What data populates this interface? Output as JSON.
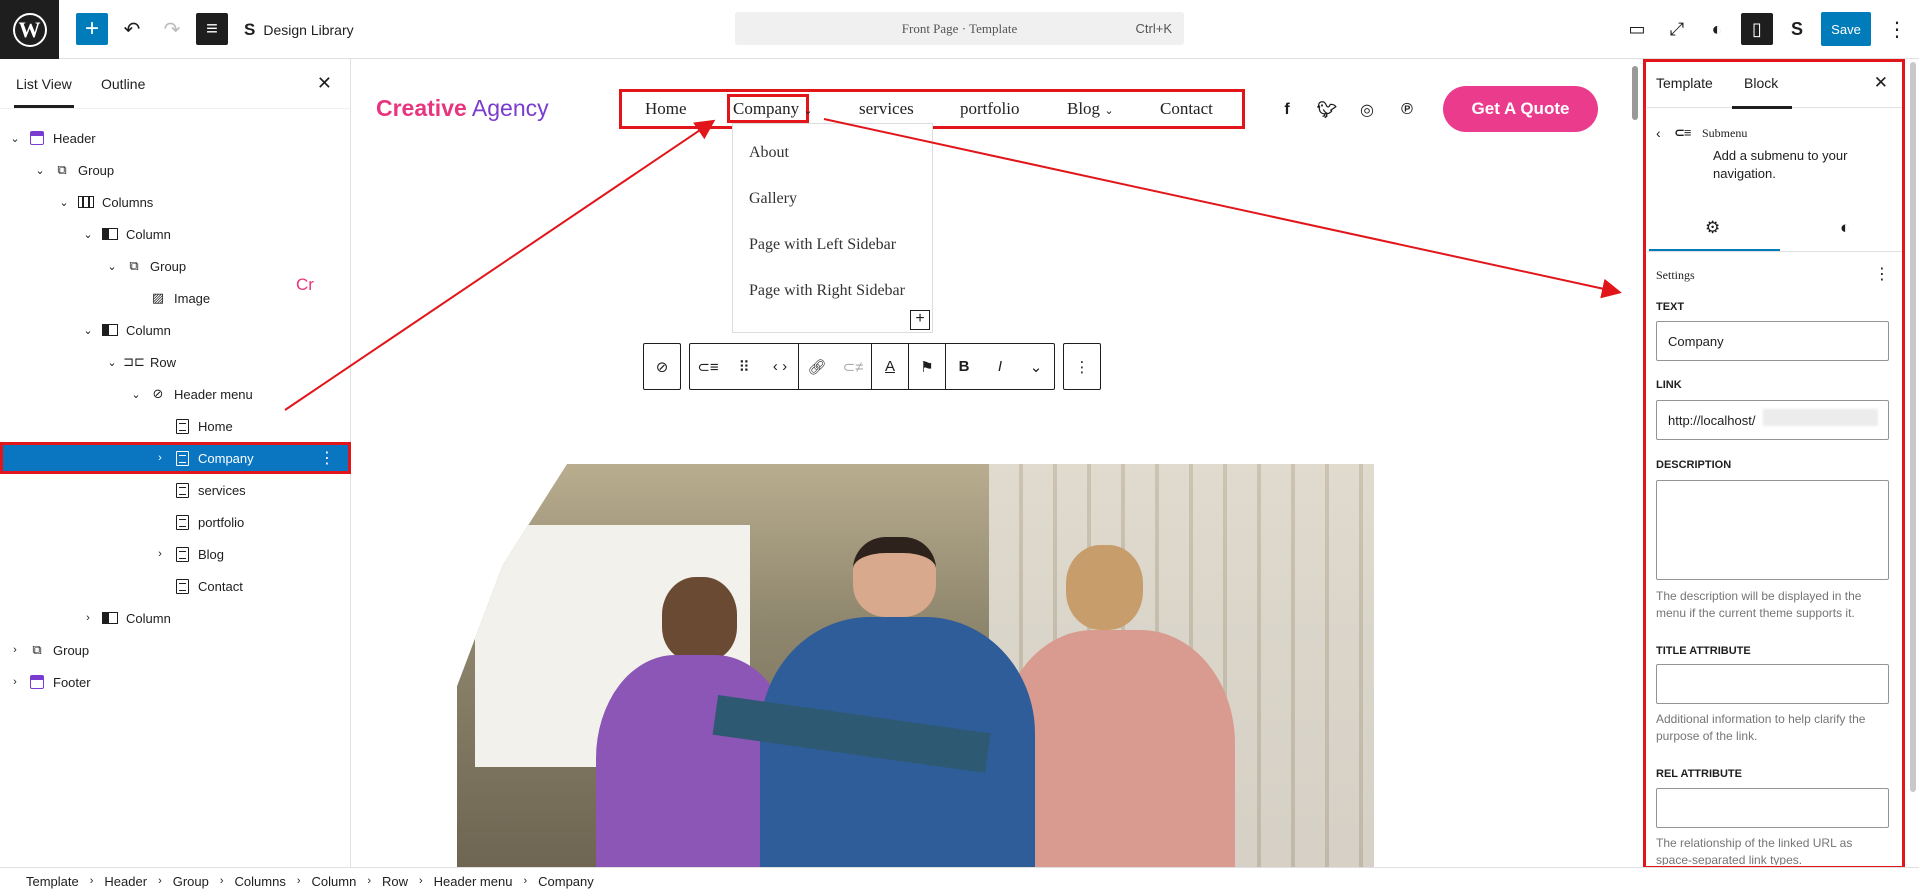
{
  "topbar": {
    "design_library": "Design Library",
    "command": "Front Page · Template",
    "shortcut": "Ctrl+K",
    "save": "Save"
  },
  "leftpanel": {
    "tab_list": "List View",
    "tab_outline": "Outline",
    "nodes": [
      {
        "label": "Header"
      },
      {
        "label": "Group"
      },
      {
        "label": "Columns"
      },
      {
        "label": "Column"
      },
      {
        "label": "Group"
      },
      {
        "label": "Image"
      },
      {
        "label": "Column"
      },
      {
        "label": "Row"
      },
      {
        "label": "Header menu"
      },
      {
        "label": "Home"
      },
      {
        "label": "Company"
      },
      {
        "label": "services"
      },
      {
        "label": "portfolio"
      },
      {
        "label": "Blog"
      },
      {
        "label": "Contact"
      },
      {
        "label": "Column"
      },
      {
        "label": "Group"
      },
      {
        "label": "Footer"
      }
    ],
    "cr": "Cr"
  },
  "canvas": {
    "brand_a": "Creative",
    "brand_b": " Agency",
    "nav": {
      "home": "Home",
      "company": "Company",
      "services": "services",
      "portfolio": "portfolio",
      "blog": "Blog",
      "contact": "Contact"
    },
    "cta": "Get A Quote",
    "submenu": [
      "About",
      "Gallery",
      "Page with Left Sidebar",
      "Page with Right Sidebar"
    ]
  },
  "inspector": {
    "tab_template": "Template",
    "tab_block": "Block",
    "block_name": "Submenu",
    "block_desc": "Add a submenu to your navigation.",
    "settings": "Settings",
    "text_label": "TEXT",
    "text_value": "Company",
    "link_label": "LINK",
    "link_value": "http://localhost/",
    "desc_label": "DESCRIPTION",
    "desc_help": "The description will be displayed in the menu if the current theme supports it.",
    "title_label": "TITLE ATTRIBUTE",
    "title_help": "Additional information to help clarify the purpose of the link.",
    "rel_label": "REL ATTRIBUTE",
    "rel_help": "The relationship of the linked URL as space-separated link types."
  },
  "breadcrumb": [
    "Template",
    "Header",
    "Group",
    "Columns",
    "Column",
    "Row",
    "Header menu",
    "Company"
  ],
  "colors": {
    "accent": "#007cba",
    "highlight": "#e2161a",
    "brand_pink": "#e8357f",
    "brand_purple": "#7a3bd0"
  }
}
